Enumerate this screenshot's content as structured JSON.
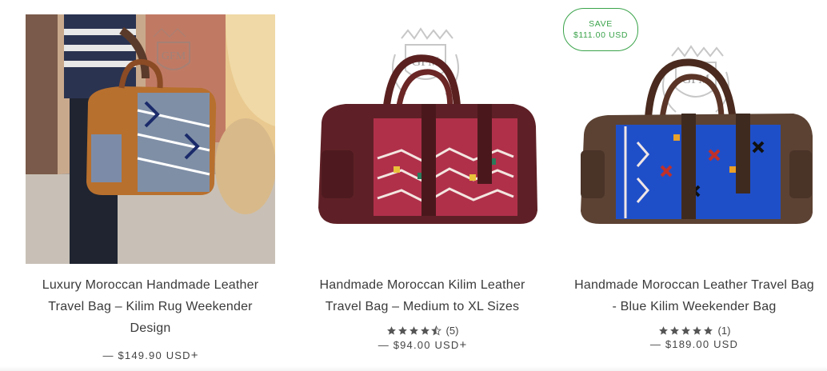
{
  "products": [
    {
      "title": "Luxury Moroccan Handmade Leather Travel Bag – Kilim Rug Weekender Design",
      "price": "— $149.90 USD",
      "variants_icon": "+",
      "watermark": "GFM"
    },
    {
      "title": "Handmade Moroccan Kilim Leather Travel Bag – Medium to XL Sizes",
      "rating": 4.5,
      "review_count": "(5)",
      "price": "— $94.00 USD",
      "variants_icon": "+",
      "watermark": "GFM"
    },
    {
      "title": "Handmade Moroccan Leather Travel Bag - Blue Kilim Weekender Bag",
      "rating": 5,
      "review_count": "(1)",
      "price": "— $189.00 USD",
      "badge": {
        "line1": "SAVE",
        "line2": "$111.00 USD"
      },
      "watermark": "GFM"
    }
  ],
  "colors": {
    "badge_green": "#3aa34a",
    "star": "#555555"
  }
}
